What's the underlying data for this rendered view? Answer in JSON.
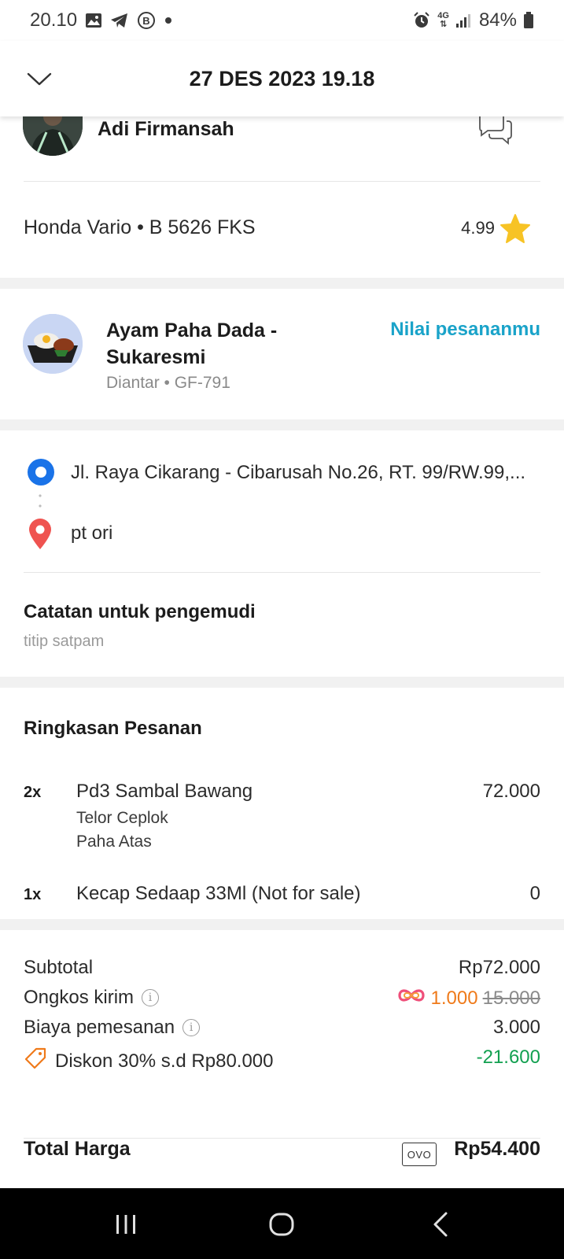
{
  "status_bar": {
    "time": "20.10",
    "network": "4G",
    "battery": "84%"
  },
  "header": {
    "title": "27 DES 2023 19.18"
  },
  "driver": {
    "name": "Adi Firmansah",
    "vehicle": "Honda Vario • B 5626 FKS",
    "rating": "4.99"
  },
  "merchant": {
    "name": "Ayam Paha Dada - Sukaresmi",
    "meta": "Diantar • GF-791",
    "rate_action": "Nilai pesananmu"
  },
  "route": {
    "pickup": "Jl. Raya Cikarang - Cibarusah No.26, RT. 99/RW.99,...",
    "dropoff": "pt ori"
  },
  "note": {
    "label": "Catatan untuk pengemudi",
    "text": "titip satpam"
  },
  "summary": {
    "title": "Ringkasan Pesanan",
    "items": [
      {
        "qty": "2x",
        "name": "Pd3 Sambal Bawang",
        "price": "72.000",
        "options": [
          "Telor Ceplok",
          "Paha Atas"
        ]
      },
      {
        "qty": "1x",
        "name": "Kecap Sedaap 33Ml (Not for sale)",
        "price": "0",
        "options": []
      }
    ]
  },
  "totals": {
    "subtotal_label": "Subtotal",
    "subtotal_value": "Rp72.000",
    "delivery_label": "Ongkos kirim",
    "delivery_value": "1.000",
    "delivery_original": "15.000",
    "fee_label": "Biaya pemesanan",
    "fee_value": "3.000",
    "discount_label": "Diskon 30% s.d Rp80.000",
    "discount_value": "-21.600",
    "total_label": "Total Harga",
    "payment_badge": "OVO",
    "total_value": "Rp54.400"
  },
  "colors": {
    "accent": "#1aa3c9",
    "promo_orange": "#ef7a1a",
    "discount_green": "#12a050",
    "star": "#f7c325",
    "pickup_blue": "#1a73e8",
    "dropoff_red": "#ef5350"
  },
  "icons": {
    "back": "chevron-down-icon",
    "chat": "chat-bubbles-icon",
    "star": "star-icon",
    "pickup": "pickup-dot-icon",
    "dropoff": "location-pin-icon",
    "info": "info-icon",
    "discount": "tag-icon",
    "promo": "promo-loop-icon"
  }
}
